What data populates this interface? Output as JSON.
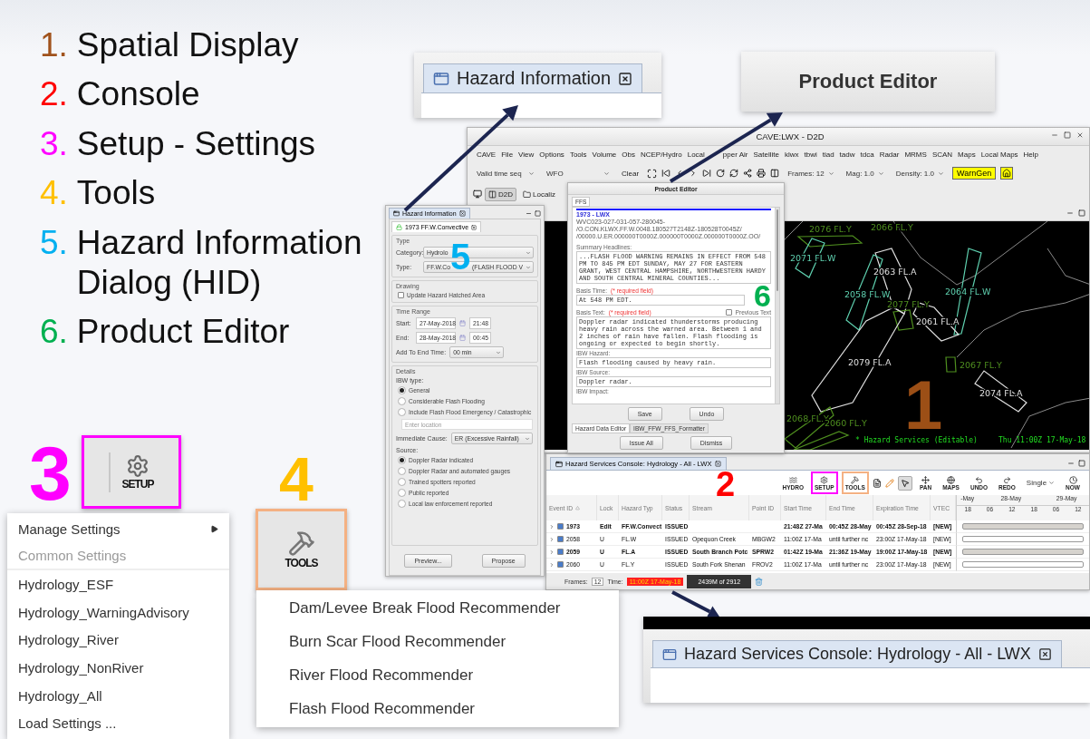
{
  "legend": [
    {
      "number": "1.",
      "label": "Spatial Display",
      "color": "#a0521c"
    },
    {
      "number": "2.",
      "label": "Console",
      "color": "#ff0000"
    },
    {
      "number": "3.",
      "label": "Setup - Settings",
      "color": "#ff00ff"
    },
    {
      "number": "4.",
      "label": "Tools",
      "color": "#ffc000"
    },
    {
      "number": "5.",
      "label": "Hazard Information Dialog (HID)",
      "color": "#00b0f0"
    },
    {
      "number": "6.",
      "label": "Product Editor",
      "color": "#00b050"
    }
  ],
  "hid_zoom": {
    "title": "Hazard Information"
  },
  "product_editor_zoom": {
    "title": "Product Editor"
  },
  "d2d": {
    "title": "CAVE:LWX - D2D",
    "menu": [
      "CAVE",
      "File",
      "View",
      "Options",
      "Tools",
      "Volume",
      "Obs",
      "NCEP/Hydro",
      "Local",
      "pper Air",
      "Satellite",
      "klwx",
      "tbwi",
      "tiad",
      "tadw",
      "tdca",
      "Radar",
      "MRMS",
      "SCAN",
      "Maps",
      "Local Maps",
      "Help"
    ],
    "toolbar": {
      "time_mode": "Valid time seq",
      "scale": "WFO",
      "clear": "Clear",
      "frames": "Frames: 12",
      "mag": "Mag: 1.0",
      "density": "Density: 1.0",
      "warngen": "WarnGen"
    },
    "perspectives": [
      {
        "label": "D2D",
        "selected": true
      },
      {
        "label": "Localiz",
        "selected": false
      }
    ],
    "map": {
      "labels": [
        {
          "text": "2076 FL.Y",
          "color": "#4f8f1f"
        },
        {
          "text": "2066 FL.Y",
          "color": "#4f8f1f"
        },
        {
          "text": "2071 FL.W",
          "color": "#5fd1b0"
        },
        {
          "text": "2063 FL.A",
          "color": "#e0e0e0"
        },
        {
          "text": "2058 FL.W",
          "color": "#5fd1b0"
        },
        {
          "text": "2064 FL.W",
          "color": "#5fd1b0"
        },
        {
          "text": "2077 FL.Y",
          "color": "#4f8f1f"
        },
        {
          "text": "2061 FL.A",
          "color": "#e0e0e0"
        },
        {
          "text": "2079 FL.A",
          "color": "#e0e0e0"
        },
        {
          "text": "2067 FL.Y",
          "color": "#4f8f1f"
        },
        {
          "text": "2074 FL.A",
          "color": "#e0e0e0"
        },
        {
          "text": "2068 FL.Y",
          "color": "#4f8f1f"
        },
        {
          "text": "2060 FL.Y",
          "color": "#4f8f1f"
        }
      ],
      "status_left": "* Hazard Services (Editable)",
      "status_right": "Thu 11:00Z 17-May-18"
    }
  },
  "hid": {
    "title": "Hazard Information",
    "tab": "1973 FF.W.Convective",
    "type_section": "Type",
    "category_label": "Category:",
    "category_value": "Hydrolo",
    "type_label": "Type:",
    "type_value_left": "FF.W.Co",
    "type_value_right": "(FLASH FLOOD V",
    "drawing_section": "Drawing",
    "hatched": {
      "label": "Update Hazard Hatched Area",
      "checked": false
    },
    "time_section": "Time Range",
    "start_label": "Start:",
    "start_date": "27-May-2018",
    "start_time": "21:48",
    "end_label": "End:",
    "end_date": "28-May-2018",
    "end_time": "00:45",
    "add_label": "Add To End Time:",
    "add_value": "00 min",
    "details_section": "Details",
    "ibw_label": "IBW type:",
    "ibw_options": [
      {
        "label": "General",
        "selected": true
      },
      {
        "label": "Considerable Flash Flooding",
        "selected": false
      },
      {
        "label": "Include Flash Flood Emergency / Catastrophic",
        "selected": false
      }
    ],
    "location_placeholder": "Enter location",
    "cause_label": "Immediate Cause:",
    "cause_value": "ER (Excessive Rainfall)",
    "source_label": "Source:",
    "source_options": [
      {
        "label": "Doppler Radar indicated",
        "selected": true
      },
      {
        "label": "Doppler Radar and automated gauges",
        "selected": false
      },
      {
        "label": "Trained spotters reported",
        "selected": false
      },
      {
        "label": "Public reported",
        "selected": false
      },
      {
        "label": "Local law enforcement reported",
        "selected": false
      }
    ],
    "buttons": [
      "Preview...",
      "Propose"
    ]
  },
  "product_editor": {
    "title": "Product Editor",
    "tab": "FFS",
    "heading": "1973 - LWX",
    "codes": [
      "WVC023-027-031-057-280045-",
      "/O.CON.KLWX.FF.W.0048.180527T2148Z-180528T0045Z/",
      "/00000.U.ER.000000T0000Z.000000T0000Z.000000T0000Z.OO/"
    ],
    "headlines_label": "Summary Headlines:",
    "headlines": "...FLASH FLOOD WARNING REMAINS IN EFFECT FROM 548 PM TO 845 PM EDT SUNDAY, MAY 27 FOR EASTERN GRANT, WEST CENTRAL HAMPSHIRE, NORTHWESTERN HARDY AND SOUTH CENTRAL MINERAL COUNTIES...",
    "basis_time_label": "Basis Time:",
    "required_time": "(* required field)",
    "basis_time": "At 548 PM EDT.",
    "basis_text_label": "Basis Text:",
    "required_text": "(* required field)",
    "previous_text": {
      "label": "Previous Text",
      "checked": false
    },
    "basis_text": "Doppler radar indicated thunderstorms producing heavy rain across the warned area. Between 1 and 2 inches of rain have fallen. Flash flooding is ongoing or expected to begin shortly.",
    "hazard_label": "IBW Hazard:",
    "hazard": "Flash flooding caused by heavy rain.",
    "source_label": "IBW Source:",
    "source": "Doppler radar.",
    "impact_label": "IBW Impact:",
    "buttons": [
      "Save",
      "Undo"
    ],
    "bottom_tabs": [
      {
        "label": "Hazard Data Editor",
        "selected": true
      },
      {
        "label": "IBW_FFW_FFS_Formatter",
        "selected": false
      }
    ],
    "footer_buttons": [
      "Issue All",
      "Dismiss"
    ]
  },
  "console": {
    "title": "Hazard Services Console: Hydrology - All - LWX",
    "buttons": [
      {
        "label": "HYDRO"
      },
      {
        "label": "SETUP",
        "color": "#ff00ff"
      },
      {
        "label": "TOOLS",
        "color": "#f4b183"
      }
    ],
    "tools": [
      "PAN",
      "MAPS",
      "UNDO",
      "REDO"
    ],
    "mode": "Single",
    "now": "NOW",
    "columns": [
      "Event ID",
      "Lock",
      "Hazard Typ",
      "Status",
      "Stream",
      "Point ID",
      "Start Time",
      "End Time",
      "Expiration Time",
      "VTEC"
    ],
    "timeline": {
      "days": [
        "-May",
        "28-May",
        "29-May"
      ],
      "hours": [
        "18",
        "06",
        "12",
        "18",
        "06",
        "12"
      ]
    },
    "rows": [
      {
        "checked": true,
        "bold": true,
        "cells": [
          "1973",
          "Edit",
          "FF.W.Convect",
          "ISSUED",
          null,
          null,
          "21:48Z 27-Ma",
          "00:45Z 28-May",
          "00:45Z 28-Sep-18",
          "[NEW]"
        ]
      },
      {
        "checked": true,
        "bold": false,
        "cells": [
          "2058",
          "U",
          "FL.W",
          "ISSUED",
          "Opequon Creek",
          "MBGW2",
          "11:00Z 17-Ma",
          "until further nc",
          "23:00Z 17-May-18",
          "[NEW]"
        ]
      },
      {
        "checked": true,
        "bold": true,
        "cells": [
          "2059",
          "U",
          "FL.A",
          "ISSUED",
          "South Branch Potc",
          "SPRW2",
          "01:42Z 19-Ma",
          "21:36Z 19-May",
          "19:00Z 17-May-18",
          "[NEW]"
        ]
      },
      {
        "checked": true,
        "bold": false,
        "cells": [
          "2060",
          "U",
          "FL.Y",
          "ISSUED",
          "South Fork Shenan",
          "FROV2",
          "11:00Z 17-Ma",
          "until further nc",
          "23:00Z 17-May-18",
          "[NEW]"
        ]
      }
    ],
    "frames_label": "Frames:",
    "frames": "12",
    "time_label": "Time:",
    "time": "11:00Z 17-May-18",
    "memory": "2439M of 2912"
  },
  "console_zoom": {
    "title": "Hazard Services Console: Hydrology - All - LWX"
  },
  "setup": {
    "label": "SETUP",
    "menu": [
      {
        "label": "Manage Settings",
        "kind": "submenu",
        "disabled": false
      },
      {
        "label": "Common Settings",
        "kind": "item",
        "disabled": true
      },
      {
        "label": "Hydrology_ESF",
        "kind": "item",
        "disabled": false
      },
      {
        "label": "Hydrology_WarningAdvisory",
        "kind": "item",
        "disabled": false
      },
      {
        "label": "Hydrology_River",
        "kind": "item",
        "disabled": false
      },
      {
        "label": "Hydrology_NonRiver",
        "kind": "item",
        "disabled": false
      },
      {
        "label": "Hydrology_All",
        "kind": "item",
        "disabled": false
      },
      {
        "label": "Load Settings ...",
        "kind": "item",
        "disabled": false
      }
    ]
  },
  "tools": {
    "label": "TOOLS",
    "menu": [
      "Dam/Levee Break Flood Recommender",
      "Burn Scar Flood Recommender",
      "River Flood Recommender",
      "Flash Flood Recommender"
    ]
  },
  "callouts": [
    {
      "label": "5",
      "color": "#00b0f0"
    },
    {
      "label": "6",
      "color": "#00b050"
    },
    {
      "label": "1",
      "color": "#9c4f16"
    },
    {
      "label": "3",
      "color": "#ff00ff"
    },
    {
      "label": "4",
      "color": "#ffc000"
    },
    {
      "label": "2",
      "color": "#ff0000"
    }
  ]
}
